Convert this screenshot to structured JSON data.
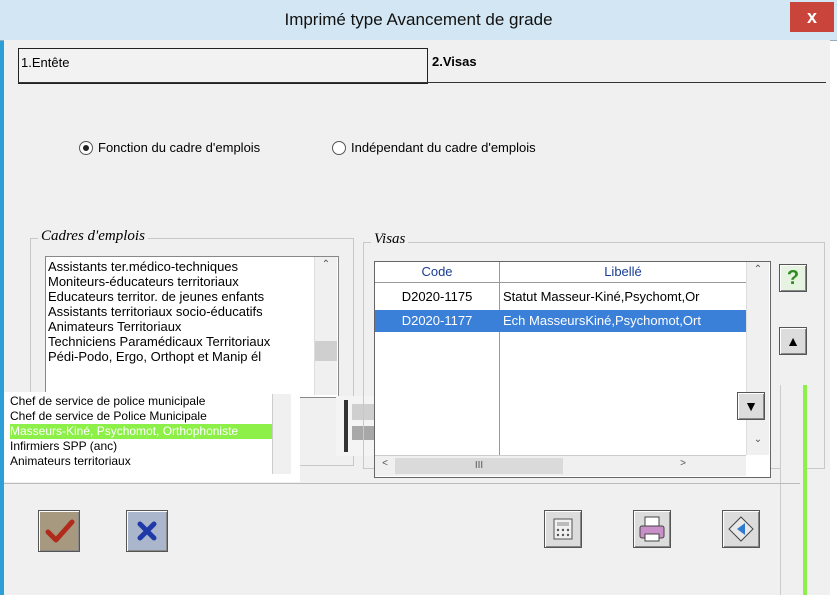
{
  "window": {
    "title": "Imprimé type Avancement de grade",
    "close_label": "x"
  },
  "tabs": [
    {
      "label": "1.Entête",
      "active": false
    },
    {
      "label": "2.Visas",
      "active": true
    }
  ],
  "mode": {
    "options": [
      "Fonction du cadre d'emplois",
      "Indépendant du cadre d'emplois"
    ],
    "selected": 0
  },
  "cadres": {
    "legend": "Cadres d'emplois",
    "items": [
      "Assistants ter.médico-techniques",
      "Moniteurs-éducateurs territoriaux",
      "Educateurs territor. de jeunes enfants",
      "Assistants territoriaux socio-éducatifs",
      "Animateurs Territoriaux",
      "Techniciens Paramédicaux Territoriaux",
      "Pédi-Podo, Ergo, Orthopt et Manip él"
    ],
    "overlay_items": [
      "Chef de service de police municipale",
      "Chef de service de Police Municipale",
      "Masseurs-Kiné, Psychomot, Orthophoniste",
      "Infirmiers SPP (anc)",
      "Animateurs territoriaux"
    ],
    "overlay_highlight_index": 2,
    "overlay_highlight_color": "#8cf049"
  },
  "visas": {
    "legend": "Visas",
    "columns": [
      "Code",
      "Libellé"
    ],
    "rows": [
      {
        "code": "D2020-1175",
        "libelle": "Statut Masseur-Kiné,Psychomt,Or",
        "selected": false
      },
      {
        "code": "D2020-1177",
        "libelle": "Ech MasseursKiné,Psychomot,Ort",
        "selected": true
      }
    ],
    "hscroll_thumb_label": "III"
  },
  "side_buttons": {
    "help": "?",
    "up": "▲",
    "down": "▼"
  },
  "footer": {
    "buttons": [
      "validate",
      "cancel",
      "calculator",
      "print",
      "back"
    ]
  },
  "colors": {
    "accent": "#2b9fd6",
    "selection": "#3a7fd8",
    "help_green": "#2e8b1f"
  }
}
